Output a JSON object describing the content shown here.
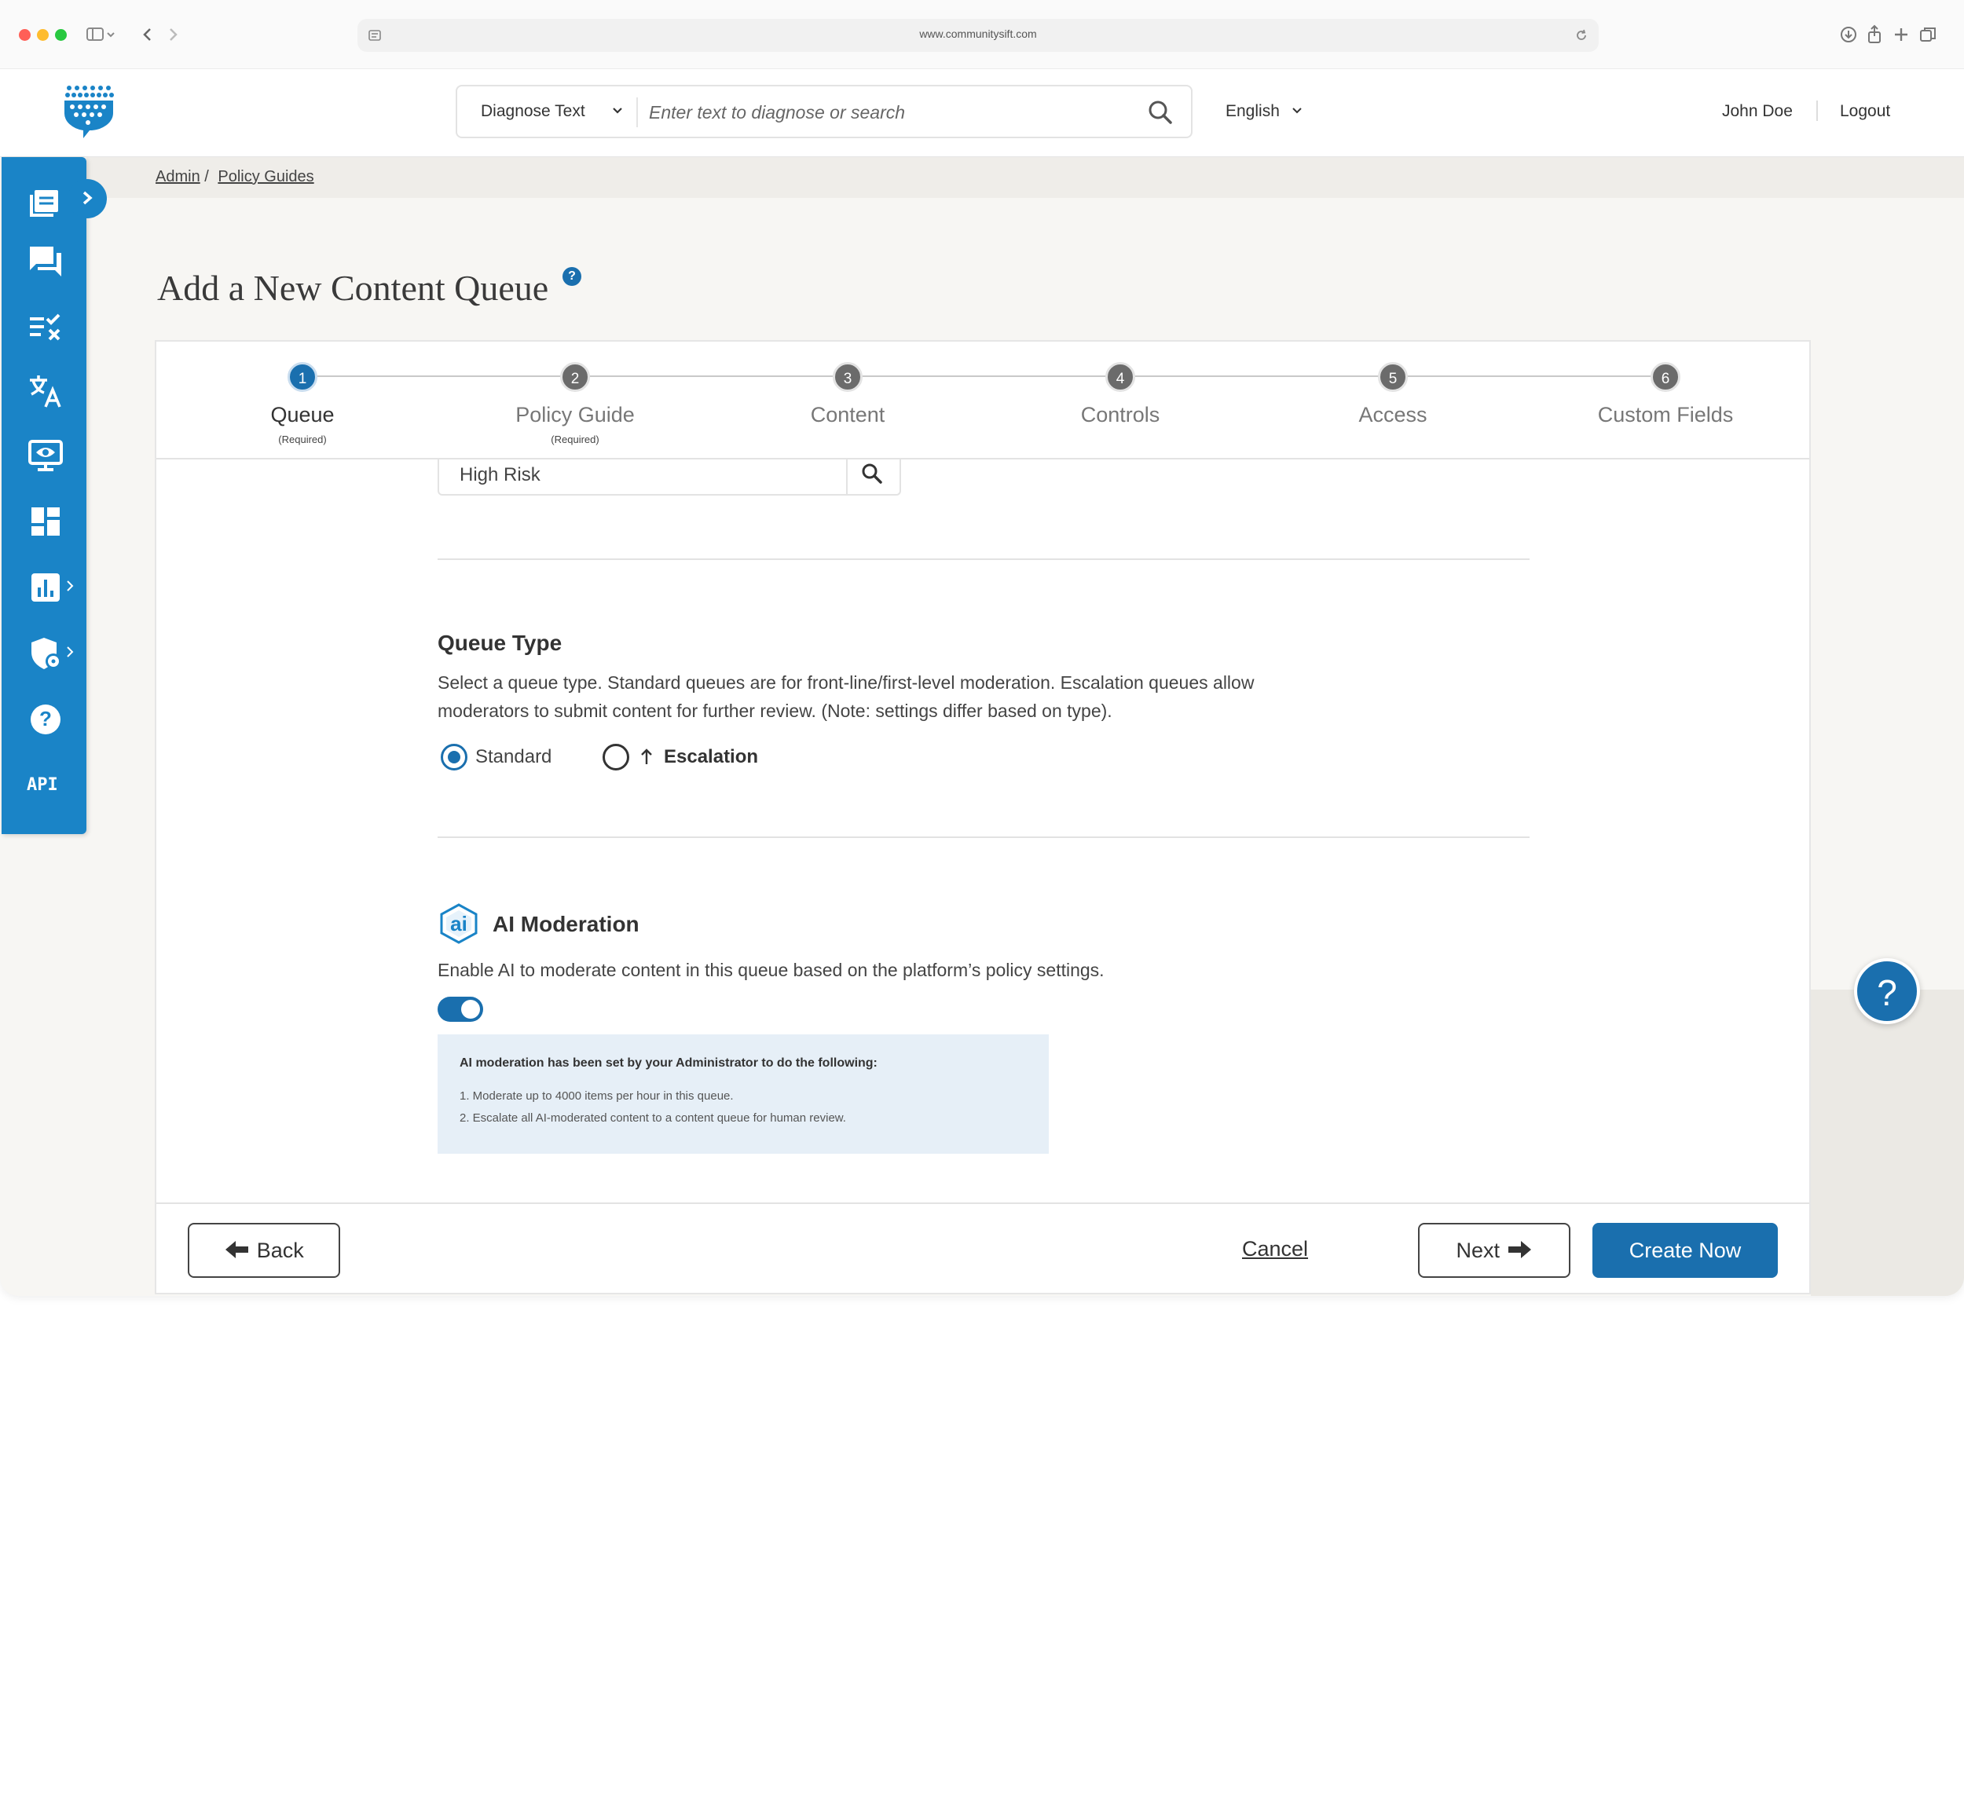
{
  "browser": {
    "url": "www.communitysift.com",
    "colors": {
      "close": "#ff5f57",
      "minimize": "#febc2e",
      "maximize": "#28c840"
    }
  },
  "header": {
    "logo_icon": "community-sift-logo",
    "diagnose_select": "Diagnose Text",
    "search_placeholder": "Enter text to diagnose or search",
    "language": "English",
    "user_name": "John Doe",
    "logout": "Logout"
  },
  "sidebar": {
    "items": [
      {
        "icon": "queues-icon"
      },
      {
        "icon": "chat-icon"
      },
      {
        "icon": "rules-icon"
      },
      {
        "icon": "translate-icon"
      },
      {
        "icon": "monitor-eye-icon"
      },
      {
        "icon": "dashboard-icon"
      },
      {
        "icon": "analytics-icon"
      },
      {
        "icon": "security-settings-icon"
      },
      {
        "icon": "help-icon"
      },
      {
        "icon": "api-icon",
        "label": "API"
      }
    ]
  },
  "breadcrumb": {
    "root": "Admin",
    "separator": "/",
    "current": "Policy Guides"
  },
  "page": {
    "title": "Add a New Content Queue"
  },
  "steps": [
    {
      "num": "1",
      "label": "Queue",
      "note": "(Required)",
      "active": true
    },
    {
      "num": "2",
      "label": "Policy Guide",
      "note": "(Required)"
    },
    {
      "num": "3",
      "label": "Content",
      "note": ""
    },
    {
      "num": "4",
      "label": "Controls",
      "note": ""
    },
    {
      "num": "5",
      "label": "Access",
      "note": ""
    },
    {
      "num": "6",
      "label": "Custom Fields",
      "note": ""
    }
  ],
  "form": {
    "policy_search_value": "High Risk",
    "queue_type": {
      "heading": "Queue Type",
      "description_1": "Select a queue type. Standard queues are for front-line/first-level moderation. Escalation queues allow",
      "description_2": "moderators to submit content for further review. (Note: settings differ based on type).",
      "standard": "Standard",
      "escalation": "Escalation",
      "selected": "Standard"
    },
    "ai": {
      "badge": "ai",
      "heading": "AI Moderation",
      "description": "Enable AI to moderate content in this queue based on the platform’s policy settings.",
      "enabled": true,
      "info_title": "AI moderation has been set by your Administrator to do the following:",
      "info_1": "1. Moderate up to 4000 items per hour in this queue.",
      "info_2": "2. Escalate all AI-moderated content to a content queue for human review."
    }
  },
  "footer": {
    "back": "Back",
    "cancel": "Cancel",
    "next": "Next",
    "create": "Create Now"
  },
  "float_help": "?"
}
